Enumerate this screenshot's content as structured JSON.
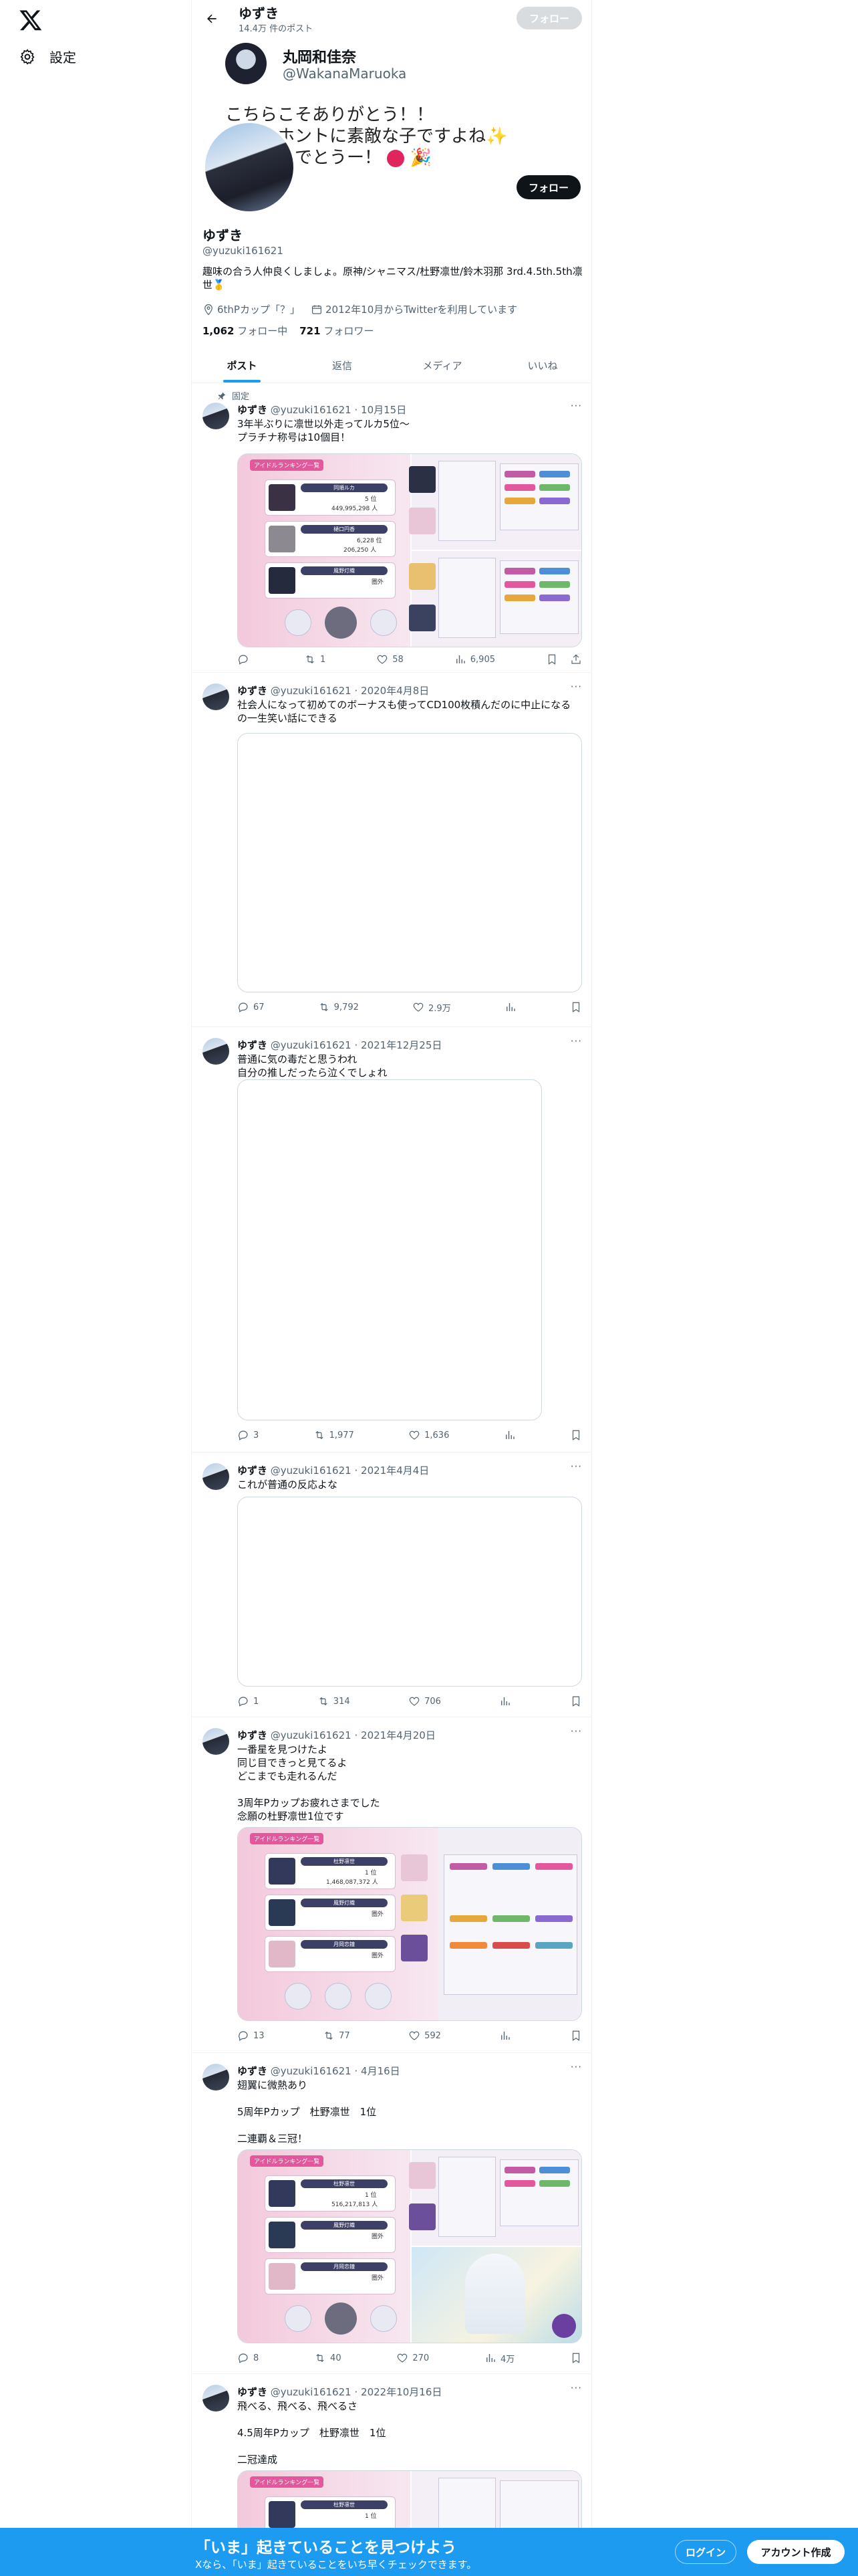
{
  "sidebar": {
    "settings_label": "設定"
  },
  "header": {
    "name": "ゆずき",
    "post_count": "14.4万 件のポスト",
    "follow_label": "フォロー"
  },
  "banner": {
    "name": "丸岡和佳奈",
    "handle": "@WakanaMaruoka",
    "line1": "こちらこそありがとう！！",
    "line2": "ほんとホントに素敵な子ですよね",
    "line3": "１位おめでとうー！"
  },
  "profile": {
    "follow_label": "フォロー",
    "name": "ゆずき",
    "handle": "@yuzuki161621",
    "bio": "趣味の合う人仲良くしましょ。原神/シャニマス/杜野凛世/鈴木羽那 3rd.4.5th.5th凛世🥇",
    "location": "6thPカップ「？」",
    "joined": "2012年10月からTwitterを利用しています",
    "following_count": "1,062",
    "following_label": "フォロー中",
    "followers_count": "721",
    "followers_label": "フォロワー"
  },
  "tabs": [
    "ポスト",
    "返信",
    "メディア",
    "いいね"
  ],
  "posts": [
    {
      "pinned": "固定",
      "name": "ゆずき",
      "handle": "@yuzuki161621",
      "date": "10月15日",
      "text": "3年半ぶりに凛世以外走ってルカ5位～\nプラチナ称号は10個目！",
      "reply": "",
      "retweet": "1",
      "like": "58",
      "views": "6,905",
      "game": {
        "tag": "アイドルランキング一覧",
        "r1": "同順ルカ",
        "r1v": "449,995,298 人",
        "r1rank": "5 位",
        "r2": "樋口円香",
        "r2v": "206,250 人",
        "r2rank": "6,228 位",
        "r3": "風野灯織",
        "r3rank": "圏外"
      }
    },
    {
      "name": "ゆずき",
      "handle": "@yuzuki161621",
      "date": "2020年4月8日",
      "text": "社会人になって初めてのボーナスも使ってCD100枚積んだのに中止になるの一生笑い話にできる",
      "reply": "67",
      "retweet": "9,792",
      "like": "2.9万",
      "views": ""
    },
    {
      "name": "ゆずき",
      "handle": "@yuzuki161621",
      "date": "2021年12月25日",
      "text": "普通に気の毒だと思うわれ\n自分の推しだったら泣くでしょれ",
      "reply": "3",
      "retweet": "1,977",
      "like": "1,636",
      "views": ""
    },
    {
      "name": "ゆずき",
      "handle": "@yuzuki161621",
      "date": "2021年4月4日",
      "text": "これが普通の反応よな",
      "reply": "1",
      "retweet": "314",
      "like": "706",
      "views": ""
    },
    {
      "name": "ゆずき",
      "handle": "@yuzuki161621",
      "date": "2021年4月20日",
      "text": "一番星を見つけたよ\n同じ目できっと見てるよ\nどこまでも走れるんだ\n\n3周年Pカップお疲れさまでした\n念願の杜野凛世1位です",
      "reply": "13",
      "retweet": "77",
      "like": "592",
      "views": "",
      "game": {
        "tag": "アイドルランキング一覧",
        "r1": "杜野凛世",
        "r1v": "1,468,087,372 人",
        "r1rank": "1 位",
        "r2": "風野灯織",
        "r2v": "",
        "r2rank": "圏外",
        "r3": "月岡恋鐘",
        "r3rank": "圏外"
      }
    },
    {
      "name": "ゆずき",
      "handle": "@yuzuki161621",
      "date": "4月16日",
      "text": "翅翼に微熱あり\n\n5周年Pカップ　杜野凛世　1位\n\n二連覇＆三冠！",
      "reply": "8",
      "retweet": "40",
      "like": "270",
      "views": "4万",
      "game": {
        "tag": "アイドルランキング一覧",
        "r1": "杜野凛世",
        "r1v": "516,217,813 人",
        "r1rank": "1 位",
        "r2": "風野灯織",
        "r2v": "",
        "r2rank": "圏外",
        "r3": "月岡恋鐘",
        "r3rank": "圏外"
      }
    },
    {
      "name": "ゆずき",
      "handle": "@yuzuki161621",
      "date": "2022年10月16日",
      "text": "飛べる、飛べる、飛べるさ\n\n4.5周年Pカップ　杜野凛世　1位\n\n二冠達成",
      "reply": "",
      "retweet": "",
      "like": "",
      "views": "",
      "game": {
        "tag": "アイドルランキング一覧",
        "r1": "杜野凛世",
        "r1v": "",
        "r1rank": "1 位"
      }
    }
  ],
  "bottom_bar": {
    "title": "「いま」起きていることを見つけよう",
    "subtitle": "Xなら、「いま」起きていることをいち早くチェックできます。",
    "login_label": "ログイン",
    "signup_label": "アカウント作成"
  },
  "icons": [
    "x-logo-icon",
    "gear-icon",
    "back-arrow-icon",
    "location-icon",
    "calendar-icon",
    "pin-icon",
    "reply-icon",
    "retweet-icon",
    "like-icon",
    "views-icon",
    "bookmark-icon",
    "share-icon",
    "more-icon"
  ],
  "colors": {
    "accent": "#1d9bf0",
    "text": "#0f1419",
    "muted": "#536471",
    "border": "#eff3f4"
  }
}
